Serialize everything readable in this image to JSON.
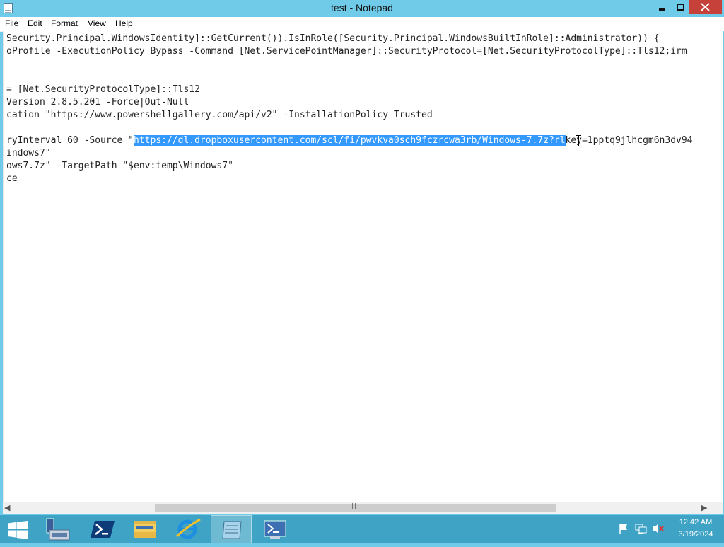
{
  "window": {
    "title": "test - Notepad",
    "close_color": "#c7413b",
    "titlebar_color": "#6fcbe8"
  },
  "menu": [
    "File",
    "Edit",
    "Format",
    "View",
    "Help"
  ],
  "editor": {
    "lines": [
      "Security.Principal.WindowsIdentity]::GetCurrent()).IsInRole([Security.Principal.WindowsBuiltInRole]::Administrator)) {",
      "oProfile -ExecutionPolicy Bypass -Command [Net.ServicePointManager]::SecurityProtocol=[Net.SecurityProtocolType]::Tls12;irm",
      "",
      "",
      "= [Net.SecurityProtocolType]::Tls12",
      "Version 2.8.5.201 -Force|Out-Null",
      "cation \"https://www.powershellgallery.com/api/v2\" -InstallationPolicy Trusted",
      "",
      "",
      "indows7\"",
      "ows7.7z\" -TargetPath \"$env:temp\\Windows7\"",
      "ce"
    ],
    "selected_line": {
      "before": "ryInterval 60 -Source \"",
      "selected": "https://dl.dropboxusercontent.com/scl/fi/pwvkva0sch9fczrcwa3rb/Windows-7.7z?rl",
      "after": "key=1pptq9jlhcgm6n3dv94"
    },
    "selection_color": "#3399ff"
  },
  "taskbar": {
    "apps": [
      "start",
      "server-manager",
      "powershell",
      "file-explorer",
      "internet-explorer",
      "notepad",
      "powershell-ise"
    ],
    "active_app": "notepad",
    "clock_time": "12:42 AM",
    "clock_date": "3/19/2024",
    "color": "#3ea3c4"
  }
}
